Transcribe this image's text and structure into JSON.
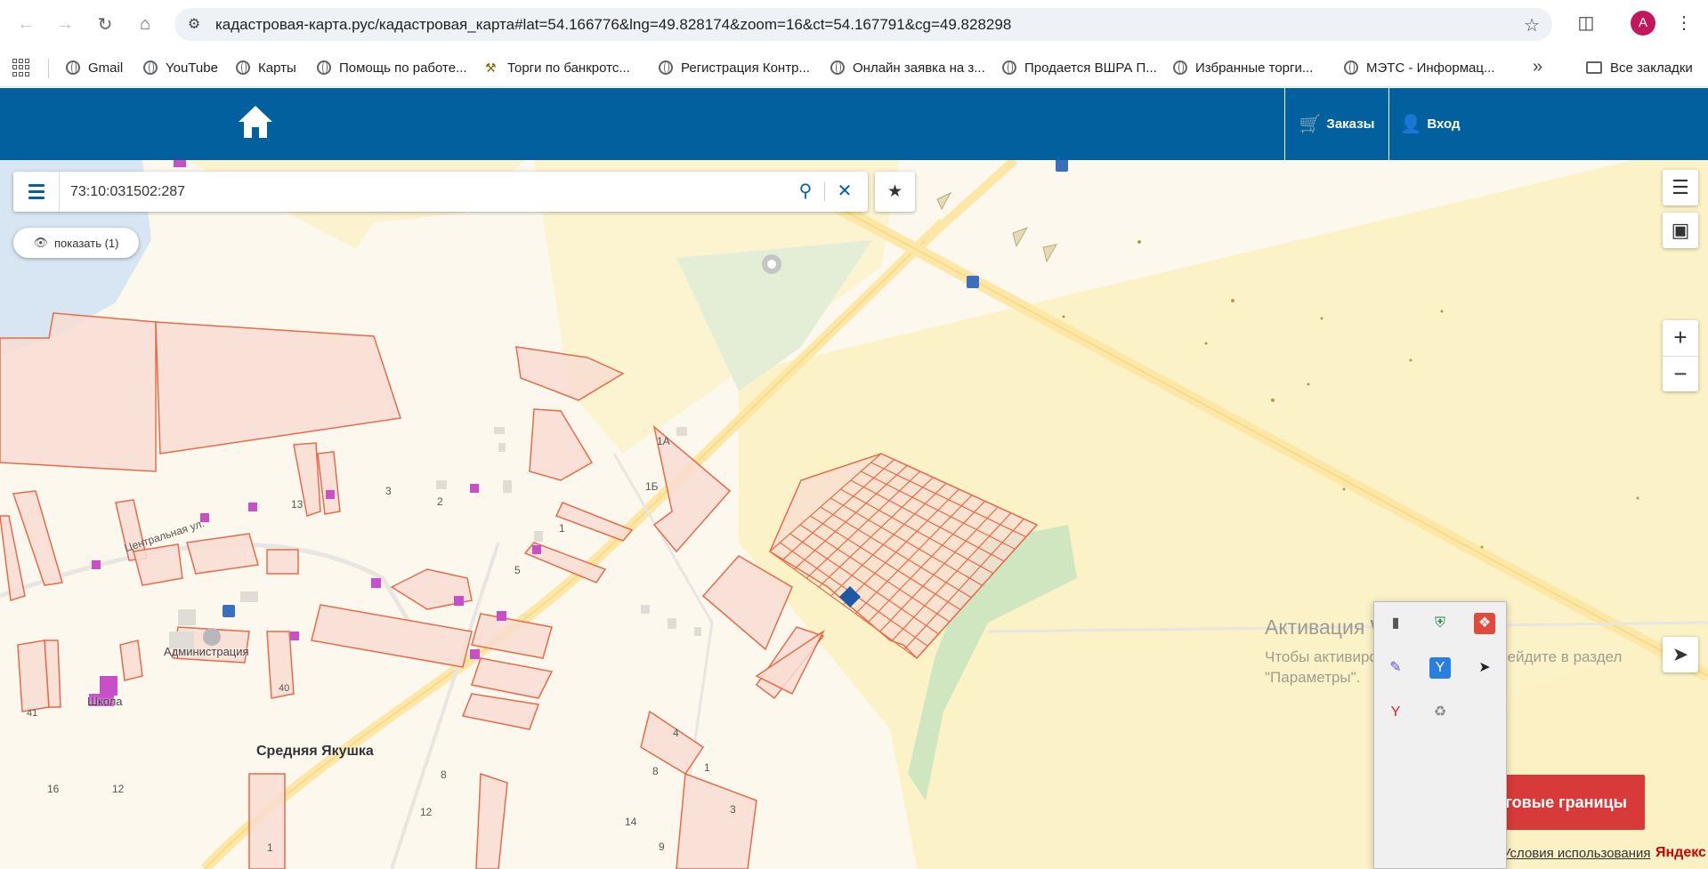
{
  "browser": {
    "url": "кадастровая-карта.рус/кадастровая_карта#lat=54.166776&lng=49.828174&zoom=16&ct=54.167791&cg=49.828298",
    "profile_initial": "A",
    "bookmarks": [
      "Gmail",
      "YouTube",
      "Карты",
      "Помощь по работе...",
      "Торги по банкротс...",
      "Регистрация Контр...",
      "Онлайн заявка на з...",
      "Продается ВШРА П...",
      "Избранные торги...",
      "МЭТС - Информац..."
    ],
    "all_bookmarks": "Все закладки"
  },
  "header": {
    "orders_label": "Заказы",
    "login_label": "Вход",
    "brand_color": "#02609e"
  },
  "search": {
    "value": "73:10:031502:287",
    "show_label": "показать (1)"
  },
  "map": {
    "village_label": "Средняя Якушка",
    "admin_label": "Администрация",
    "school_label": "Школа",
    "street_label": "Центральная ул.",
    "house_numbers": [
      "1А",
      "1Б",
      "3",
      "2",
      "13",
      "1",
      "5",
      "40",
      "41",
      "4",
      "8",
      "1",
      "3",
      "16",
      "12",
      "8",
      "12",
      "14",
      "9",
      "1"
    ],
    "parcel_color": "#e86b4a"
  },
  "overlay": {
    "boundary_button": "говые границы",
    "windows_title": "Активация Windows",
    "windows_text_1": "Чтобы активировать Windows, перейдите в раздел",
    "windows_text_2": "\"Параметры\".",
    "terms": "Условия использования",
    "yandex": "Яндекс"
  }
}
